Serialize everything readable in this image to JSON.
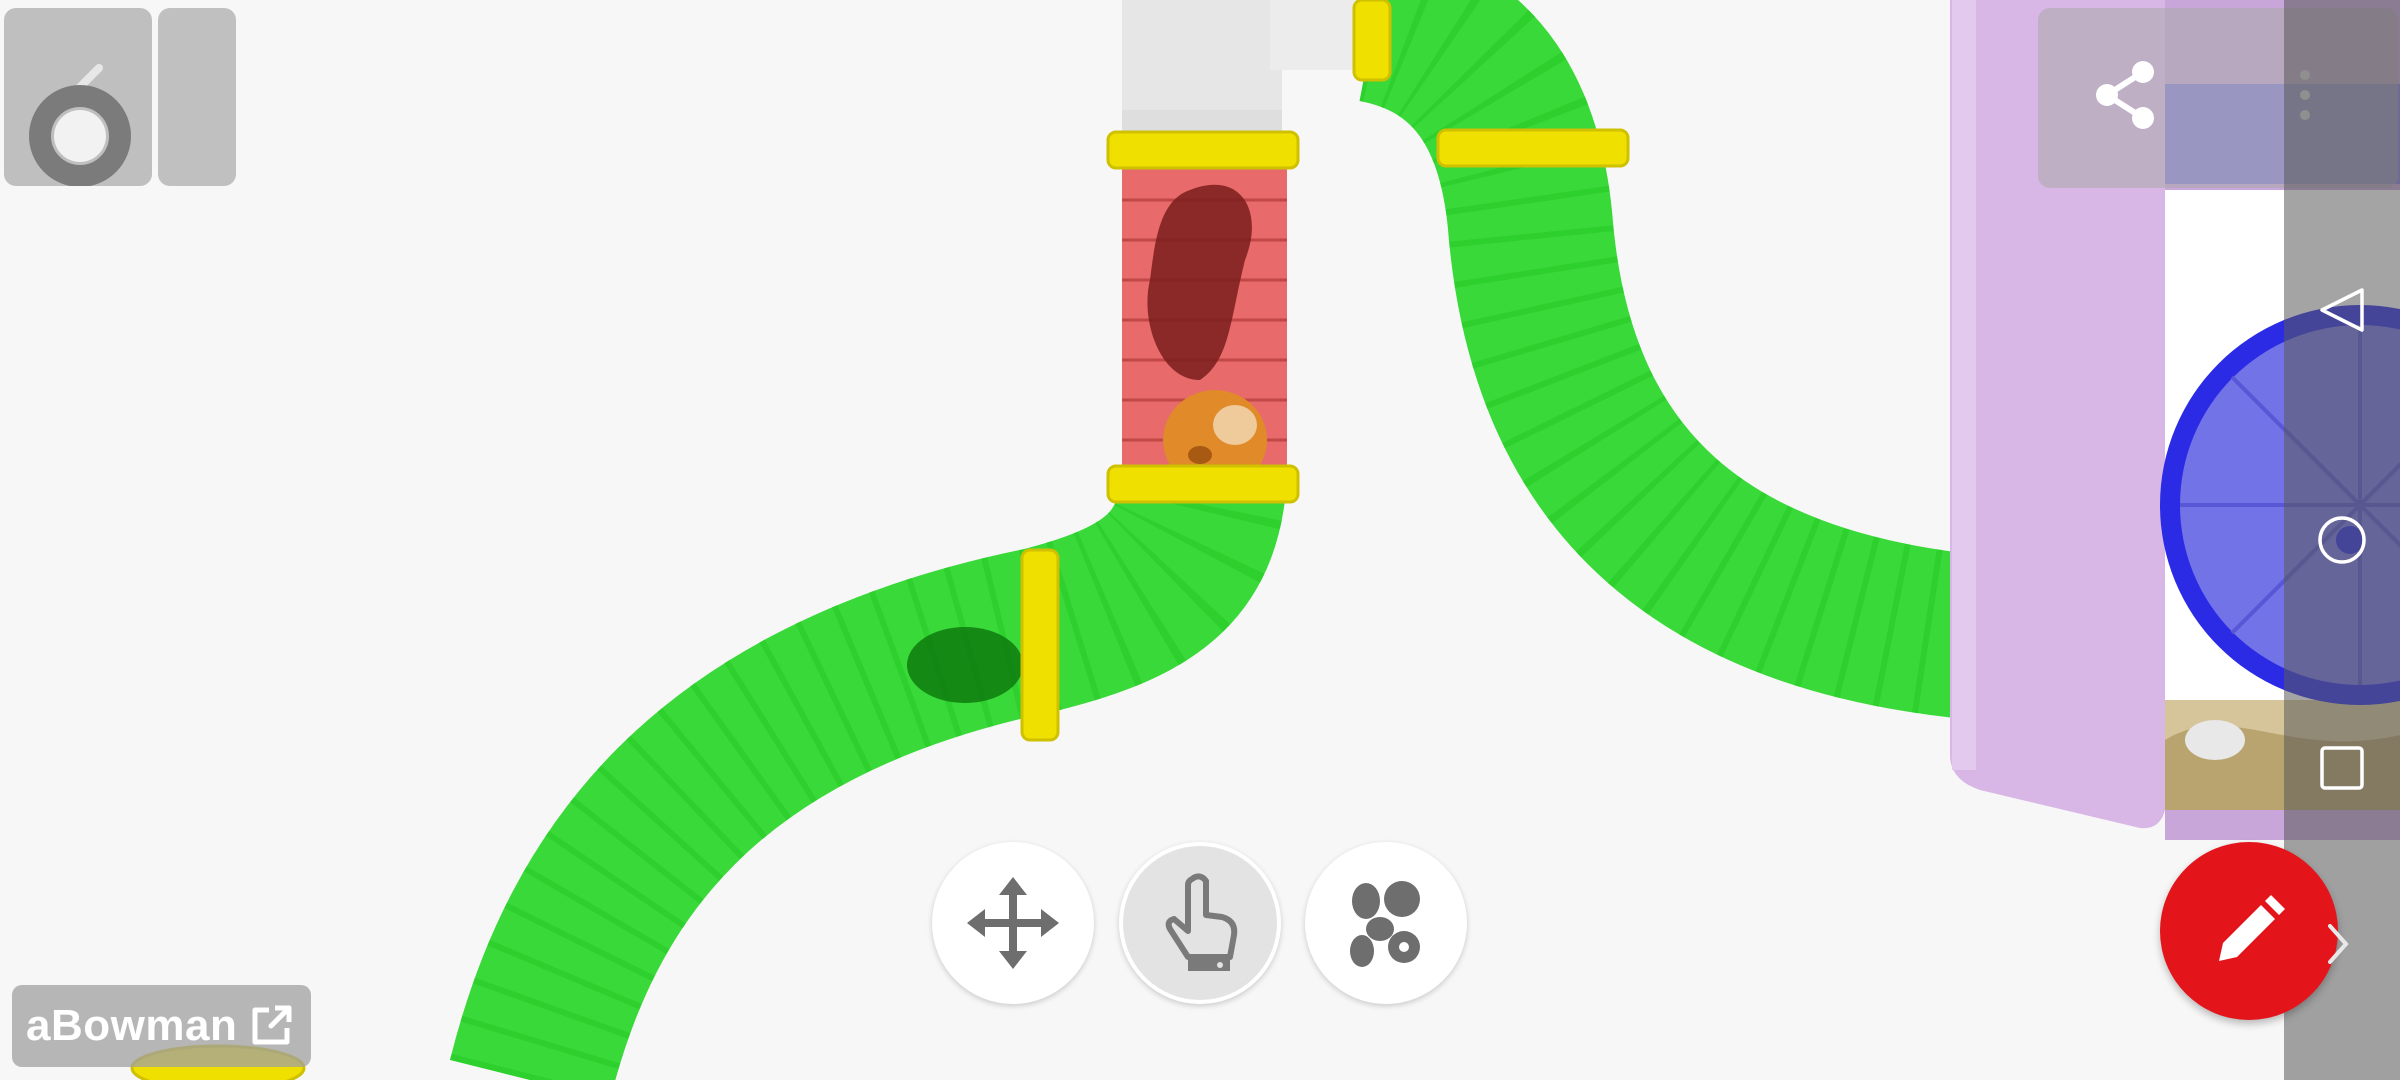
{
  "app": {
    "logo_icon": "six-logo-icon"
  },
  "toolbar": {
    "move_tool_icon": "move-arrows-icon",
    "touch_tool_icon": "pointing-hand-icon",
    "food_tool_icon": "food-pellets-icon",
    "edit_icon": "pencil-icon",
    "share_icon": "share-icon",
    "more_icon": "more-vertical-icon"
  },
  "author": {
    "name": "aBowman",
    "link_icon": "external-link-icon"
  },
  "navigation": {
    "back_icon": "triangle-back-icon",
    "home_icon": "circle-home-icon",
    "recents_icon": "square-recents-icon"
  },
  "colors": {
    "tube_green": "#22dd22",
    "tube_red": "#e23b3b",
    "connector_yellow": "#f0e000",
    "cage_lilac": "#d6b3e6",
    "wheel_blue": "#2b2be6",
    "edit_red": "#e4141b"
  }
}
